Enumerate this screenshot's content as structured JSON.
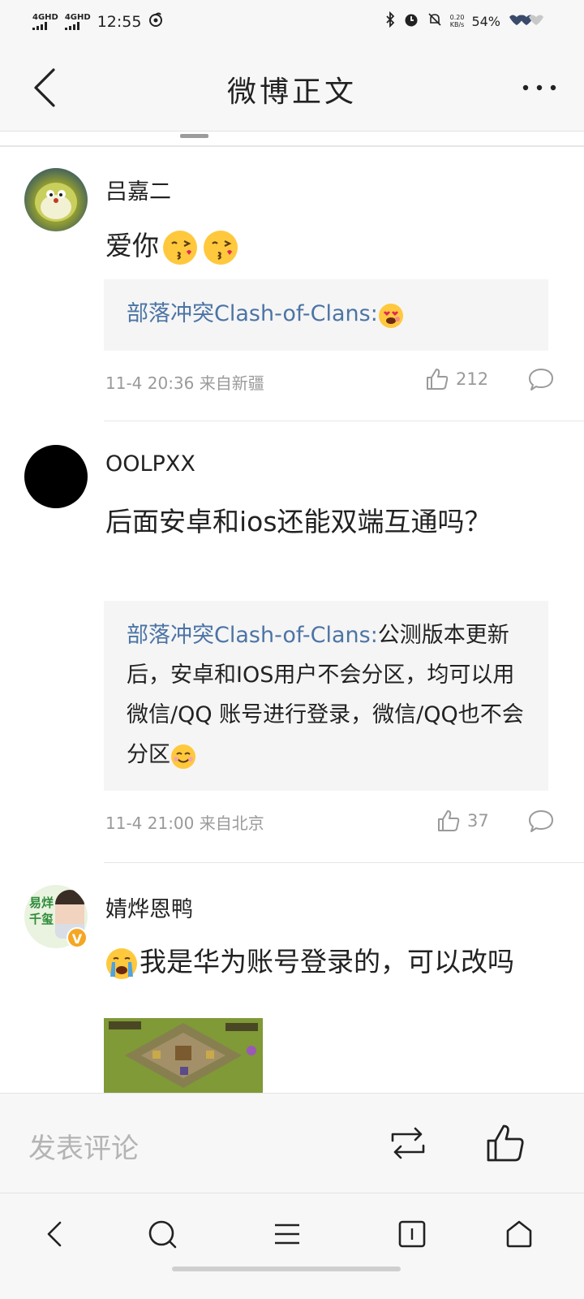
{
  "status_bar": {
    "sim1": "4GHD",
    "sim2": "4GHD",
    "time": "12:55",
    "net_speed_value": "0.20",
    "net_speed_unit": "KB/s",
    "battery": "54%"
  },
  "header": {
    "title": "微博正文"
  },
  "comments": [
    {
      "username": "吕嘉二",
      "text": "爱你",
      "reply_author": "部落冲突Clash-of-Clans:",
      "reply_text": "",
      "time": "11-4 20:36 来自新疆",
      "likes": "212"
    },
    {
      "username": "OOLPXX",
      "text": "后面安卓和ios还能双端互通吗？",
      "reply_author": "部落冲突Clash-of-Clans:",
      "reply_text": "公测版本更新后，安卓和IOS用户不会分区，均可以用微信/QQ 账号进行登录，微信/QQ也不会分区",
      "time": "11-4 21:00 来自北京",
      "likes": "37"
    },
    {
      "username": "婧烨恩鸭",
      "text": "我是华为账号登录的，可以改吗",
      "avatar_line1": "易烊",
      "avatar_line2": "千玺"
    }
  ],
  "bottom_bar": {
    "comment_placeholder": "发表评论"
  },
  "colors": {
    "link_blue": "#4c74a5",
    "meta_gray": "#9a9a9a",
    "badge_orange": "#f5a623"
  },
  "icons": [
    "back-arrow-icon",
    "more-icon",
    "like-icon",
    "comment-icon",
    "repost-icon",
    "verified-icon"
  ]
}
